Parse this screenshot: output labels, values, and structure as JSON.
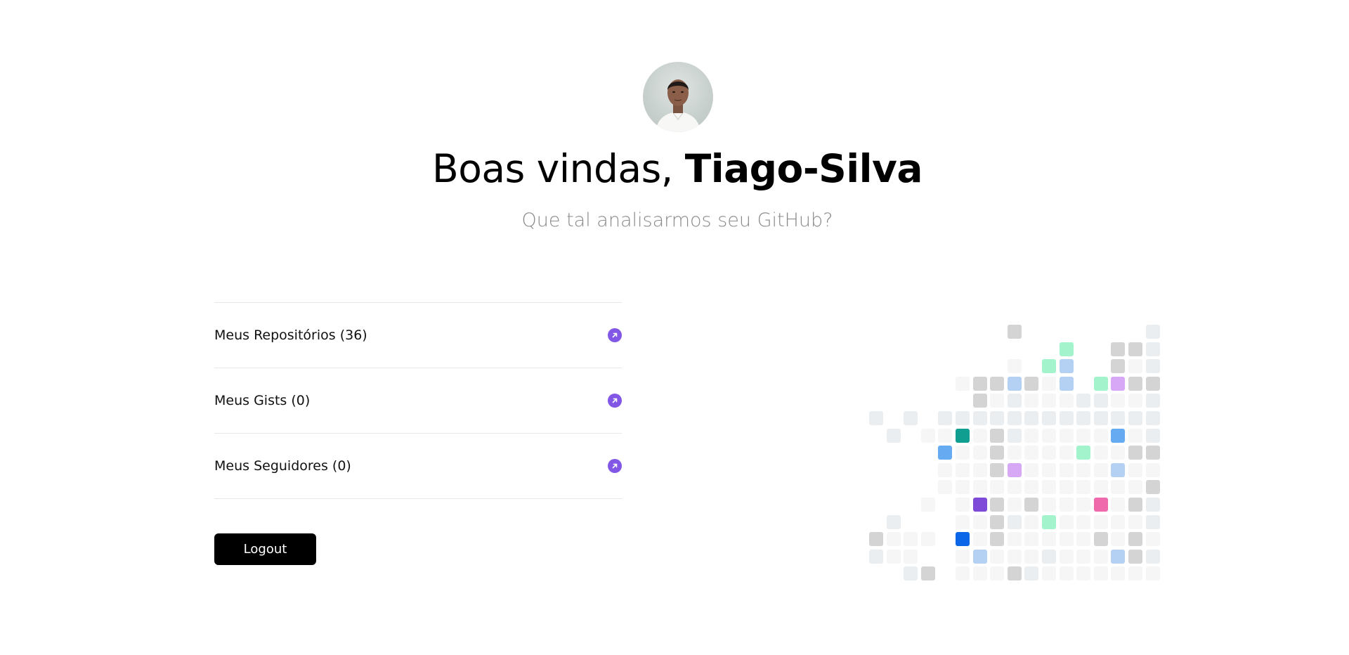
{
  "header": {
    "greeting": "Boas vindas, ",
    "username": "Tiago-Silva",
    "subtitle": "Que tal analisarmos seu GitHub?"
  },
  "menu": {
    "items": [
      {
        "label": "Meus Repositórios (36)"
      },
      {
        "label": "Meus Gists (0)"
      },
      {
        "label": "Meus Seguidores (0)"
      }
    ]
  },
  "actions": {
    "logout_label": "Logout"
  },
  "colors": {
    "accent": "#8257e5",
    "button_bg": "#000000",
    "divider": "#e8e8e8",
    "subtitle": "#8a8a8a"
  },
  "icons": {
    "menu_arrow": "arrow-up-right-circle-icon"
  }
}
